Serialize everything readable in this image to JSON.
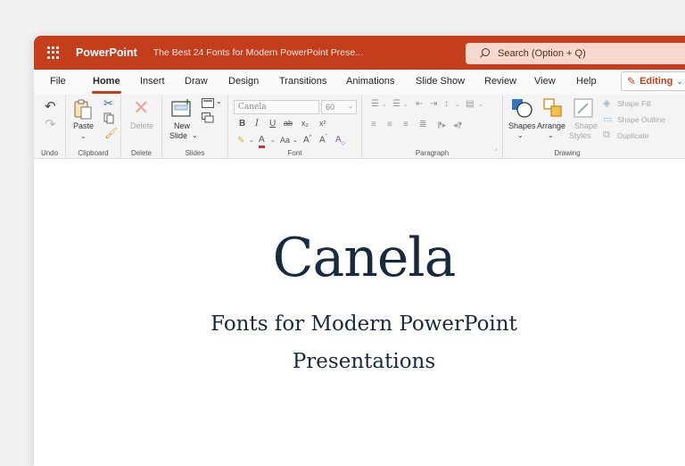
{
  "titlebar": {
    "app_name": "PowerPoint",
    "doc_title": "The Best 24 Fonts for Modern PowerPoint Prese...",
    "search_placeholder": "Search (Option + Q)"
  },
  "tabs": [
    "File",
    "Home",
    "Insert",
    "Draw",
    "Design",
    "Transitions",
    "Animations",
    "Slide Show",
    "Review",
    "View",
    "Help"
  ],
  "active_tab": "Home",
  "mode": {
    "label": "Editing"
  },
  "ribbon": {
    "undo": {
      "group_label": "Undo"
    },
    "clipboard": {
      "paste_label": "Paste",
      "group_label": "Clipboard"
    },
    "delete": {
      "delete_label": "Delete",
      "group_label": "Delete"
    },
    "slides": {
      "new_slide_line1": "New",
      "new_slide_line2": "Slide",
      "group_label": "Slides"
    },
    "font": {
      "font_name": "Canela",
      "font_size": "60",
      "group_label": "Font"
    },
    "paragraph": {
      "group_label": "Paragraph"
    },
    "drawing": {
      "shapes_label": "Shapes",
      "arrange_label": "Arrange",
      "shape_styles_line1": "Shape",
      "shape_styles_line2": "Styles",
      "shape_fill": "Shape Fill",
      "shape_outline": "Shape Outline",
      "duplicate": "Duplicate",
      "group_label": "Drawing"
    }
  },
  "slide": {
    "title": "Canela",
    "subtitle_line1": "Fonts for Modern PowerPoint",
    "subtitle_line2": "Presentations"
  },
  "colors": {
    "brand": "#c43e1c",
    "slide_text": "#172a3e"
  }
}
